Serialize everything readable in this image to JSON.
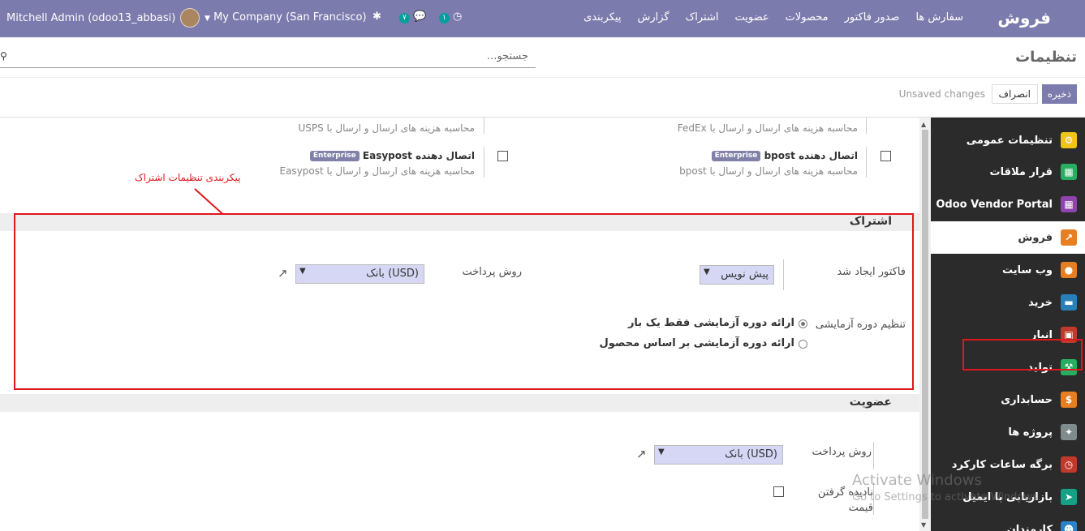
{
  "navbar": {
    "brand": "فروش",
    "menu": [
      "سفارش ها",
      "صدور فاکتور",
      "محصولات",
      "عضویت",
      "اشتراک",
      "گزارش",
      "پیکربندی"
    ],
    "company": "My Company (San Francisco)",
    "user": "Mitchell Admin (odoo13_abbasi)",
    "chat_count": "۷",
    "activity_count": "۱"
  },
  "control_panel": {
    "title": "تنظیمات",
    "search_placeholder": "جستجو...",
    "save_label": "ذخیره",
    "discard_label": "انصراف",
    "unsaved": "Unsaved changes"
  },
  "sidebar": {
    "items": [
      {
        "label": "تنظیمات عمومی",
        "icon": "gear-icon",
        "color": "#f0c419"
      },
      {
        "label": "قرار ملاقات",
        "icon": "calendar-icon",
        "color": "#27ae60"
      },
      {
        "label": "Odoo Vendor Portal",
        "icon": "grid-icon",
        "color": "#8e44ad"
      },
      {
        "label": "فروش",
        "icon": "chart-icon",
        "color": "#e67e22"
      },
      {
        "label": "وب سایت",
        "icon": "globe-icon",
        "color": "#e67e22"
      },
      {
        "label": "خرید",
        "icon": "card-icon",
        "color": "#2980b9"
      },
      {
        "label": "انبار",
        "icon": "box-icon",
        "color": "#c0392b"
      },
      {
        "label": "تولید",
        "icon": "wrench-icon",
        "color": "#27ae60"
      },
      {
        "label": "حسابداری",
        "icon": "dollar-icon",
        "color": "#e67e22"
      },
      {
        "label": "پروژه ها",
        "icon": "puzzle-icon",
        "color": "#7f8c8d"
      },
      {
        "label": "برگه ساعات کارکرد",
        "icon": "timer-icon",
        "color": "#c0392b"
      },
      {
        "label": "بازاریابی با ایمیل",
        "icon": "send-icon",
        "color": "#16a085"
      },
      {
        "label": "کارمندان",
        "icon": "people-icon",
        "color": "#2c82c9"
      }
    ]
  },
  "shipping": {
    "fedex_desc": "محاسبه هزینه های ارسال و ارسال با FedEx",
    "usps_desc": "محاسبه هزینه های ارسال و ارسال با USPS",
    "bpost_title": "اتصال دهنده bpost",
    "bpost_desc": "محاسبه هزینه های ارسال و ارسال با bpost",
    "easypost_title": "اتصال دهنده Easypost",
    "easypost_desc": "محاسبه هزینه های ارسال و ارسال با Easypost",
    "enterprise": "Enterprise"
  },
  "annotation": "پیکربندی تنظیمات اشتراک",
  "subscription": {
    "title": "اشتراک",
    "invoice_label": "فاکتور ایجاد شد",
    "invoice_value": "پیش نویس",
    "payment_label": "روش پرداخت",
    "payment_value": "بانک (USD)",
    "trial_label": "تنظیم دوره آزمایشی",
    "trial_option1": "ارائه دوره آزمایشی فقط یک بار",
    "trial_option2": "ارائه دوره آزمایشی بر اساس محصول"
  },
  "membership": {
    "title": "عضویت",
    "payment_label": "روش پرداخت",
    "payment_value": "بانک (USD)",
    "ignore_label_1": "نادیده گرفتن",
    "ignore_label_2": "قیمت"
  },
  "watermark": {
    "line1": "Activate Windows",
    "line2": "Go to Settings to activate Windows."
  }
}
